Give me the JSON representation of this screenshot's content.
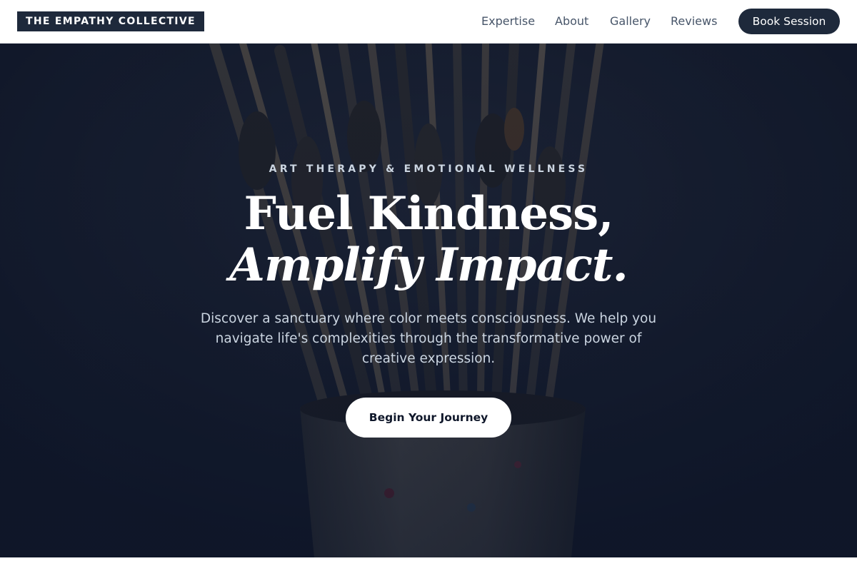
{
  "brand": {
    "name": "THE EMPATHY COLLECTIVE"
  },
  "nav": {
    "links": [
      "Expertise",
      "About",
      "Gallery",
      "Reviews"
    ],
    "cta_label": "Book Session"
  },
  "hero": {
    "eyebrow": "ART THERAPY & EMOTIONAL WELLNESS",
    "headline_line1": "Fuel Kindness,",
    "headline_line2": "Amplify Impact.",
    "lead": "Discover a sanctuary where color meets consciousness. We help you navigate life's complexities through the transformative power of creative expression.",
    "cta_label": "Begin Your Journey",
    "background_image": "paint-brushes-in-jar-photo"
  },
  "colors": {
    "brand_dark": "#1e293b",
    "hero_overlay": "#0f172a",
    "nav_text": "#475569",
    "hero_subtext": "#cbd5e1",
    "white": "#ffffff"
  }
}
